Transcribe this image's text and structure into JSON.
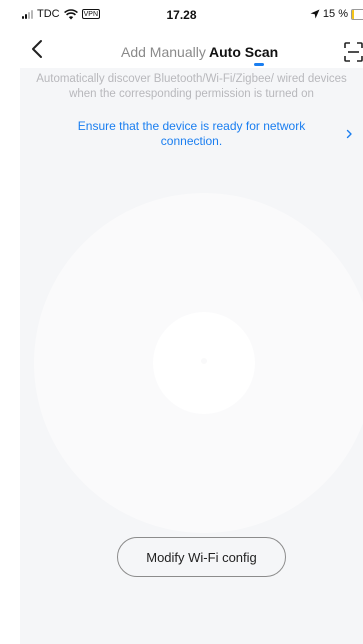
{
  "status_bar": {
    "carrier": "TDC",
    "vpn": "VPN",
    "time": "17.28",
    "battery": "15 %",
    "battery_level": 0.15,
    "battery_color": "#f5c518"
  },
  "nav": {
    "back_icon": "chevron-left-icon",
    "tabs": [
      {
        "label": "Add Manually",
        "active": false
      },
      {
        "label": "Auto Scan",
        "active": true
      }
    ],
    "scan_icon": "qr-scan-icon"
  },
  "main": {
    "description": "Automatically discover Bluetooth/Wi-Fi/Zigbee/ wired devices when the corresponding permission is turned on",
    "ready_link": "Ensure that the device is ready for network connection.",
    "modify_button": "Modify Wi-Fi config"
  },
  "colors": {
    "accent": "#1a7ef0",
    "muted_text": "#b8b8bc",
    "panel_background": "#f5f6f8"
  }
}
